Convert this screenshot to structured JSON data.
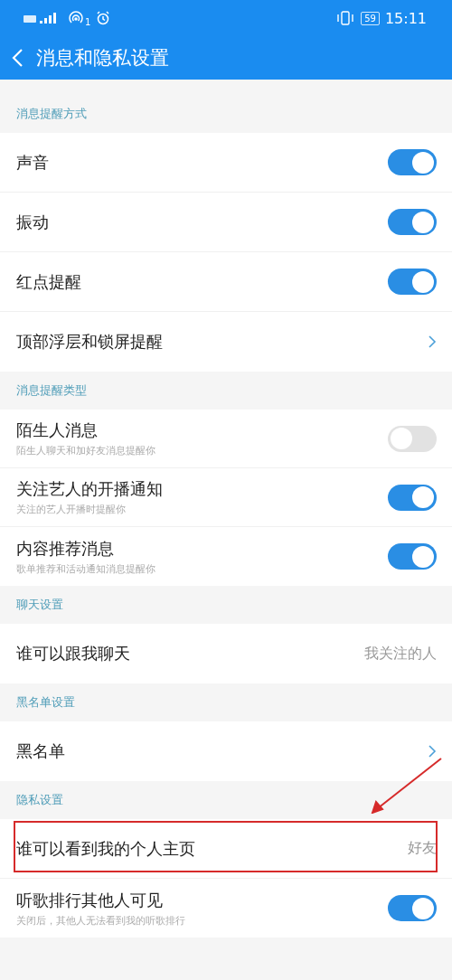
{
  "status_bar": {
    "hotspot_badge": "1",
    "battery": "59",
    "time": "15:11"
  },
  "header": {
    "title": "消息和隐私设置"
  },
  "sections": [
    {
      "title": "消息提醒方式",
      "items": [
        {
          "kind": "toggle",
          "label": "声音",
          "on": true
        },
        {
          "kind": "toggle",
          "label": "振动",
          "on": true
        },
        {
          "kind": "toggle",
          "label": "红点提醒",
          "on": true
        },
        {
          "kind": "link",
          "label": "顶部浮层和锁屏提醒"
        }
      ]
    },
    {
      "title": "消息提醒类型",
      "items": [
        {
          "kind": "toggle",
          "label": "陌生人消息",
          "subtitle": "陌生人聊天和加好友消息提醒你",
          "on": false
        },
        {
          "kind": "toggle",
          "label": "关注艺人的开播通知",
          "subtitle": "关注的艺人开播时提醒你",
          "on": true
        },
        {
          "kind": "toggle",
          "label": "内容推荐消息",
          "subtitle": "歌单推荐和活动通知消息提醒你",
          "on": true
        }
      ]
    },
    {
      "title": "聊天设置",
      "items": [
        {
          "kind": "value",
          "label": "谁可以跟我聊天",
          "value": "我关注的人"
        }
      ]
    },
    {
      "title": "黑名单设置",
      "items": [
        {
          "kind": "link",
          "label": "黑名单"
        }
      ]
    },
    {
      "title": "隐私设置",
      "items": [
        {
          "kind": "value",
          "label": "谁可以看到我的个人主页",
          "value": "好友",
          "annotated": true
        },
        {
          "kind": "toggle",
          "label": "听歌排行其他人可见",
          "subtitle": "关闭后，其他人无法看到我的听歌排行",
          "on": true
        }
      ]
    }
  ]
}
